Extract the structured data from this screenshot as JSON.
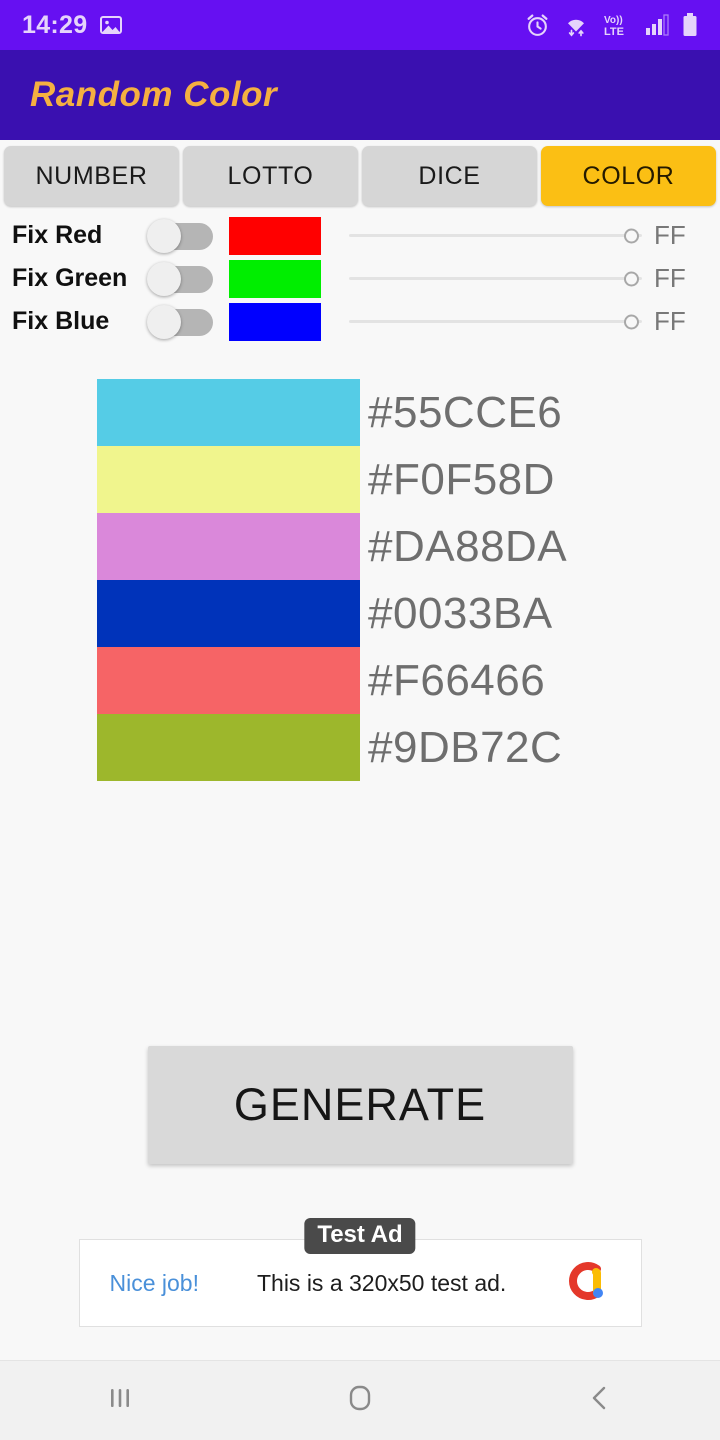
{
  "status_bar": {
    "time": "14:29",
    "left_icons": [
      "image-icon"
    ],
    "right_icons": [
      "alarm-icon",
      "wifi-icon",
      "volte-icon",
      "signal-icon",
      "battery-icon"
    ],
    "volte_top": "Vo))",
    "volte_bottom": "LTE",
    "background": "#6610F2"
  },
  "app_bar": {
    "title": "Random Color",
    "background": "#3A10B0",
    "title_color": "#F5B041"
  },
  "tabs": [
    {
      "label": "NUMBER",
      "active": false
    },
    {
      "label": "LOTTO",
      "active": false
    },
    {
      "label": "DICE",
      "active": false
    },
    {
      "label": "COLOR",
      "active": true
    }
  ],
  "tab_colors": {
    "active_bg": "#FBBF14",
    "inactive_bg": "#D6D6D6"
  },
  "fix_rows": [
    {
      "label": "Fix Red",
      "toggle_on": false,
      "swatch": "#FF0000",
      "slider_value": "FF",
      "slider_percent": 100
    },
    {
      "label": "Fix Green",
      "toggle_on": false,
      "swatch": "#00EE00",
      "slider_value": "FF",
      "slider_percent": 100
    },
    {
      "label": "Fix Blue",
      "toggle_on": false,
      "swatch": "#0000FF",
      "slider_value": "FF",
      "slider_percent": 100
    }
  ],
  "generated_colors": [
    {
      "hex": "#55CCE6",
      "label": "#55CCE6"
    },
    {
      "hex": "#F0F58D",
      "label": "#F0F58D"
    },
    {
      "hex": "#DA88DA",
      "label": "#DA88DA"
    },
    {
      "hex": "#0033BA",
      "label": "#0033BA"
    },
    {
      "hex": "#F66466",
      "label": "#F66466"
    },
    {
      "hex": "#9DB72C",
      "label": "#9DB72C"
    }
  ],
  "generate": {
    "label": "GENERATE",
    "background": "#D9D9D9"
  },
  "ad": {
    "cta": "Nice job!",
    "text": "This is a 320x50 test ad.",
    "badge": "Test Ad",
    "logo": "admob-logo"
  },
  "nav_bar": {
    "recents": "recents-icon",
    "home": "home-icon",
    "back": "back-icon"
  },
  "page_background": "#F8F8F8"
}
